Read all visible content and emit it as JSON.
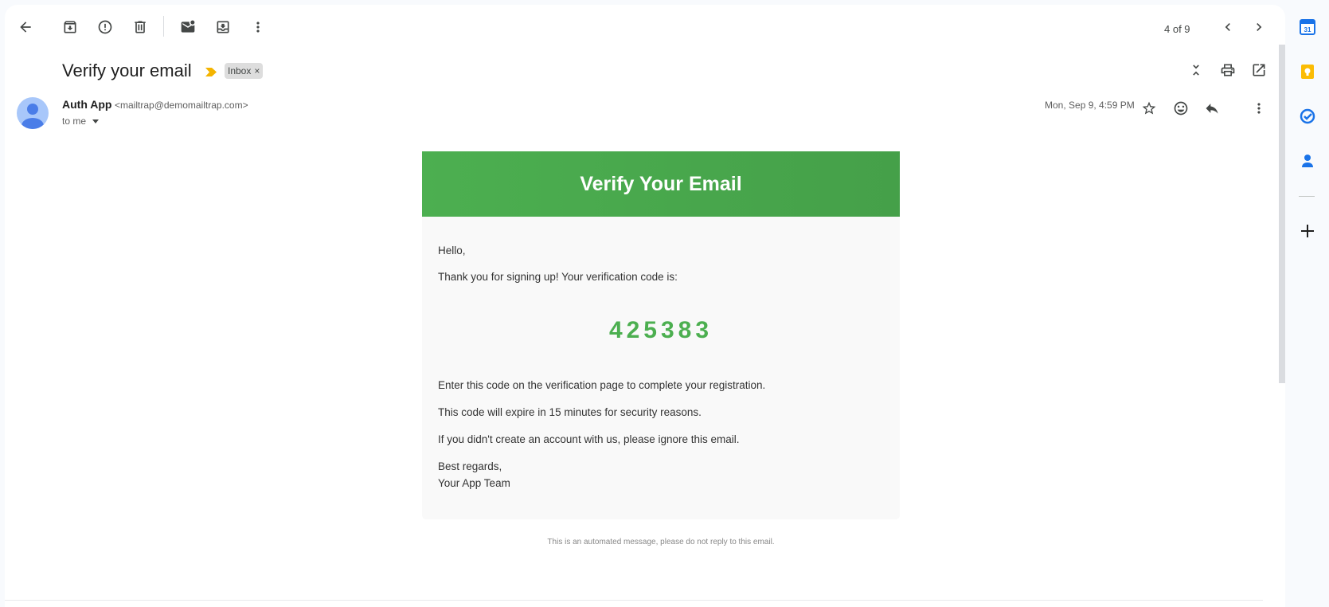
{
  "toolbar": {
    "back": "back-arrow-icon",
    "archive": "archive-icon",
    "report_spam": "report-spam-icon",
    "delete": "trash-icon",
    "mark_unread": "mark-unread-icon",
    "move_to": "move-to-inbox-icon",
    "more": "more-vert-icon",
    "page_count": "4 of 9",
    "newer": "chevron-left-icon",
    "older": "chevron-right-icon"
  },
  "message": {
    "subject": "Verify your email",
    "label": "Inbox",
    "label_remove": "×",
    "sender_name": "Auth App",
    "sender_email": "<mailtrap@demomailtrap.com>",
    "recipients": "to me",
    "date": "Mon, Sep 9, 4:59 PM"
  },
  "email": {
    "header_title": "Verify Your Email",
    "greeting": "Hello,",
    "intro": "Thank you for signing up! Your verification code is:",
    "code": "425383",
    "instruction": "Enter this code on the verification page to complete your registration.",
    "expiry": "This code will expire in 15 minutes for security reasons.",
    "ignore_note": "If you didn't create an account with us, please ignore this email.",
    "sign_off": "Best regards,",
    "signature": "Your App Team",
    "footer": "This is an automated message, please do not reply to this email."
  },
  "side_panel": {
    "apps": [
      "calendar-icon",
      "keep-icon",
      "tasks-icon",
      "contacts-icon"
    ],
    "calendar_day": "31"
  },
  "colors": {
    "email_green": "#4caf50",
    "importance_yellow": "#f4b400",
    "avatar_blue": "#a8c7fa"
  }
}
